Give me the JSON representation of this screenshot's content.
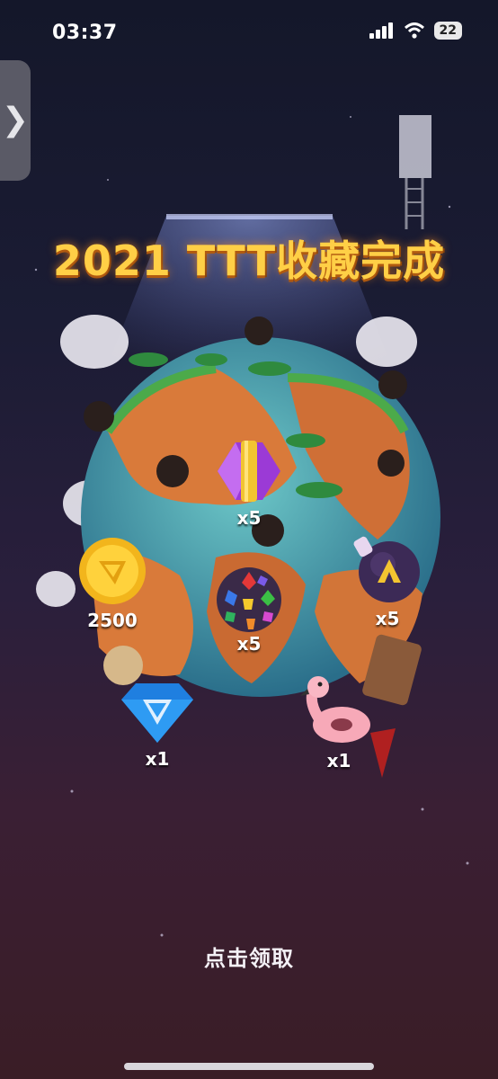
{
  "status_bar": {
    "time": "03:37",
    "battery": "22"
  },
  "header": {
    "title": "2021 TTT收藏完成"
  },
  "side_tab": {
    "glyph": "❯"
  },
  "rewards": [
    {
      "name": "purple-gem-booster",
      "quantity": "x5"
    },
    {
      "name": "coin",
      "quantity": "2500"
    },
    {
      "name": "bomb-booster",
      "quantity": "x5"
    },
    {
      "name": "color-ball-booster",
      "quantity": "x5"
    },
    {
      "name": "blue-gem",
      "quantity": "x1"
    },
    {
      "name": "flamingo-float",
      "quantity": "x1"
    }
  ],
  "footer": {
    "claim_label": "点击领取"
  },
  "colors": {
    "title": "#ffcf46",
    "background_top": "#14172a",
    "background_bottom": "#3a1d26"
  }
}
